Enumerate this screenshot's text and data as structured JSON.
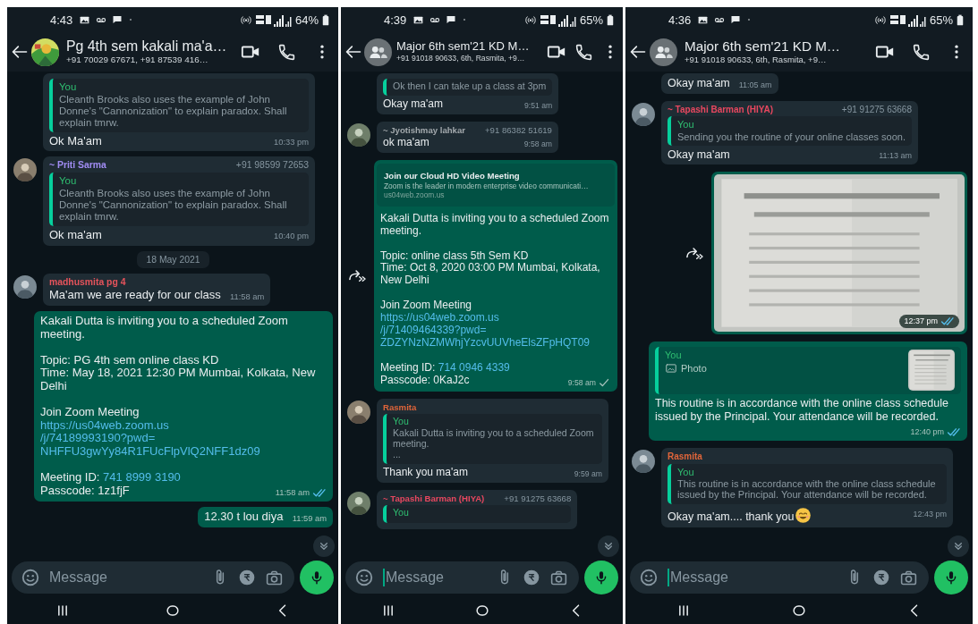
{
  "phones": [
    {
      "status_bar": {
        "time": "4:43",
        "battery": "64%"
      },
      "header": {
        "title": "Pg 4th sem kakali ma'a…",
        "subtitle": "+91 70029 67671, +91 87539 416…"
      },
      "messages": [
        {
          "kind": "incoming",
          "avatar": false,
          "quote": {
            "author": "You",
            "lines": [
              "Cleanth Brooks also uses the example of John Donne's \"Cannonization\" to explain paradox. Shall explain tmrw."
            ]
          },
          "text": "Ok Ma'am",
          "time": "10:33 pm"
        },
        {
          "kind": "incoming",
          "avatar": true,
          "sender": "~ Priti Sarma",
          "phone": "+91 98599 72653",
          "color": "#a08cf2",
          "quote": {
            "author": "You",
            "lines": [
              "Cleanth Brooks also uses the example of John Donne's \"Cannonization\" to explain paradox. Shall explain tmrw."
            ]
          },
          "text": "Ok ma'am",
          "time": "10:40 pm"
        },
        {
          "kind": "date",
          "text": "18 May 2021"
        },
        {
          "kind": "incoming",
          "avatar": true,
          "sender": "madhusmita pg 4",
          "color": "#e5535b",
          "text": "Ma'am we are ready for our class",
          "time": "11:58 am"
        },
        {
          "kind": "outgoing",
          "paragraphs": [
            [
              {
                "text": "Kakali Dutta is inviting you to a scheduled Zoom meeting."
              }
            ],
            [
              {
                "text": "Topic: PG 4th sem online class KD"
              },
              {
                "text": "Time: May 18, 2021 12:30 PM Mumbai, Kolkata, New Delhi"
              }
            ],
            [
              {
                "text": "Join Zoom Meeting"
              },
              {
                "link": "https://us04web.zoom.us"
              },
              {
                "link": "/j/74189993190?pwd="
              },
              {
                "link": "NHFFU3gwYy84R1FUcFlpVlQ2NFF1dz09"
              }
            ],
            [
              {
                "text": "Meeting ID: ",
                "link": "741 8999 3190"
              },
              {
                "text": "Passcode: 1z1fjF"
              }
            ]
          ],
          "time": "11:58 am",
          "receipt": {
            "kind": "read"
          }
        },
        {
          "kind": "outgoing",
          "paragraphs": [
            [
              {
                "text": "12.30 t lou diya"
              }
            ]
          ],
          "time": "11:59 am"
        }
      ],
      "scroll_down_button": true,
      "composer": {
        "placeholder": "Message",
        "focused": false
      }
    },
    {
      "status_bar": {
        "time": "4:39",
        "battery": "65%"
      },
      "header": {
        "avatar": {
          "kind": "group"
        },
        "title": "Major 6th sem'21 KD M…",
        "subtitle": "+91 91018 90633, 6th, Rasmita, +9…"
      },
      "messages": [
        {
          "kind": "incoming",
          "avatar": false,
          "quote": {
            "lines": [
              "Ok then I can take up a class at 3pm"
            ]
          },
          "text": "Okay ma'am",
          "time": "9:51 am"
        },
        {
          "kind": "incoming",
          "avatar": true,
          "sender": "~ Jyotishmay lahkar",
          "phone": "+91 86382 51619",
          "color": "#a3a9ad",
          "text": "ok ma'am",
          "time": "9:58 am"
        },
        {
          "kind": "outgoing",
          "forward": true,
          "preview": {
            "title": "Join our Cloud HD Video Meeting",
            "description": "Zoom is the leader in modern enterprise video communicati…",
            "url": "us04web.zoom.us"
          },
          "paragraphs": [
            [
              {
                "text": "Kakali Dutta is inviting you to a scheduled Zoom meeting."
              }
            ],
            [
              {
                "text": "Topic: online class 5th Sem KD"
              },
              {
                "text": "Time: Oct 8, 2020 03:00 PM Mumbai, Kolkata, New Delhi"
              }
            ],
            [
              {
                "text": "Join Zoom Meeting"
              },
              {
                "link": "https://us04web.zoom.us"
              },
              {
                "link": "/j/71409464339?pwd="
              },
              {
                "link": "ZDZYNzNZMWhjYzcvUUVheElsZFpHQT09"
              }
            ],
            [
              {
                "text": "Meeting ID: ",
                "link": "714 0946 4339"
              },
              {
                "text": "Passcode: 0KaJ2c"
              }
            ]
          ],
          "time": "9:58 am",
          "receipt": {
            "kind": "sent"
          }
        },
        {
          "kind": "incoming",
          "avatar": true,
          "sender": "Rasmita",
          "color": "#e0653a",
          "quote": {
            "author": "You",
            "lines": [
              "Kakali Dutta is inviting you to a scheduled Zoom meeting.",
              "..."
            ]
          },
          "text": "Thank you ma'am",
          "time": "9:59 am"
        },
        {
          "kind": "incoming",
          "avatar": true,
          "sender": "~ Tapashi Barman (HIYA)",
          "phone": "+91 91275 63668",
          "color": "#e8475f",
          "quote": {
            "author": "You"
          }
        }
      ],
      "scroll_down_button": true,
      "composer": {
        "placeholder": "Message",
        "focused": true
      }
    },
    {
      "status_bar": {
        "time": "4:36",
        "battery": "65%"
      },
      "header": {
        "avatar": {
          "kind": "group"
        },
        "title": "Major 6th sem'21 KD M…",
        "subtitle": "+91 91018 90633, 6th, Rasmita, +9…"
      },
      "messages": [
        {
          "kind": "incoming",
          "avatar": false,
          "text": "Okay ma'am",
          "time": "11:05 am"
        },
        {
          "kind": "incoming",
          "avatar": true,
          "sender": "~ Tapashi Barman (HIYA)",
          "phone": "+91 91275 63668",
          "color": "#e8475f",
          "quote": {
            "author": "You",
            "lines": [
              "Sending you the routine of your online classes soon."
            ]
          },
          "text": "Okay ma'am",
          "time": "11:13 am"
        },
        {
          "kind": "outgoing",
          "forward": true,
          "time": "12:37 pm",
          "receipt": {
            "kind": "read"
          }
        },
        {
          "kind": "outgoing",
          "quote": {
            "author": "You",
            "attachment": "Photo"
          },
          "paragraphs": [
            [
              {
                "text": "This routine is in accordance with the online class schedule issued by the Principal. Your attendance will be recorded."
              }
            ]
          ],
          "time": "12:40 pm",
          "receipt": {
            "kind": "read"
          }
        },
        {
          "kind": "incoming",
          "avatar": true,
          "sender": "Rasmita",
          "color": "#e0653a",
          "quote": {
            "author": "You",
            "lines": [
              "This routine is in accordance with the online class schedule issued by the Principal. Your attendance will be recorded."
            ]
          },
          "text": "Okay ma'am.... thank you",
          "emoji": {
            "kind": "smile"
          },
          "time": "12:43 pm"
        }
      ],
      "scroll_down_button": true,
      "composer": {
        "placeholder": "Message",
        "focused": true
      }
    }
  ]
}
